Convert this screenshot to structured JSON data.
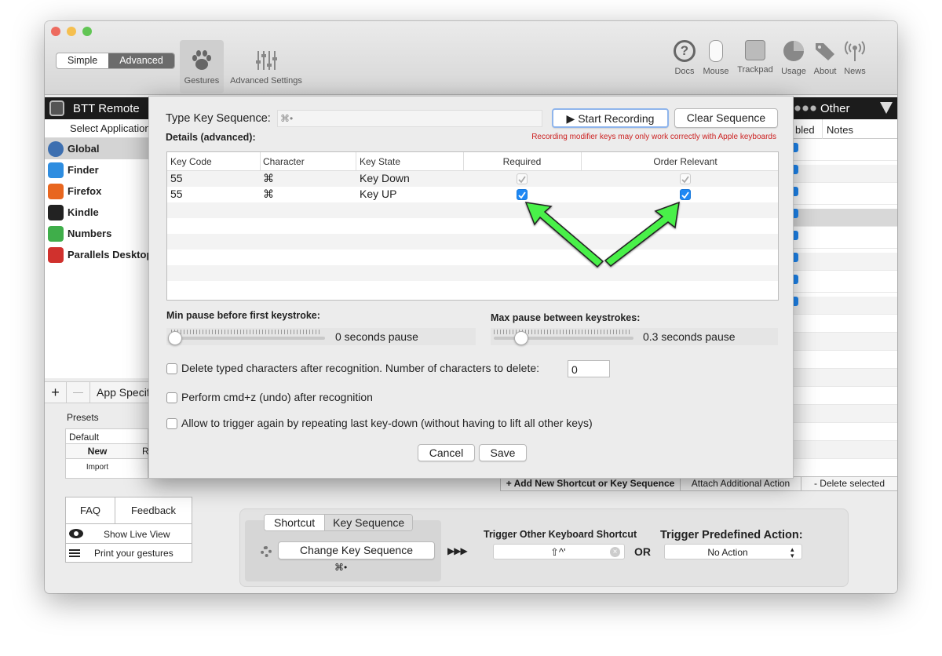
{
  "window": {
    "mode_simple": "Simple",
    "mode_advanced": "Advanced",
    "toolbar_left": [
      {
        "label": "Gestures",
        "icon": "paw-icon"
      },
      {
        "label": "Advanced Settings",
        "icon": "sliders-icon"
      }
    ],
    "toolbar_right": [
      {
        "label": "Docs",
        "icon": "question-icon"
      },
      {
        "label": "Mouse",
        "icon": "mouse-icon"
      },
      {
        "label": "Trackpad",
        "icon": "trackpad-icon"
      },
      {
        "label": "Usage",
        "icon": "pie-icon"
      },
      {
        "label": "About",
        "icon": "tag-icon"
      },
      {
        "label": "News",
        "icon": "antenna-icon"
      }
    ]
  },
  "sidebar": {
    "header_title": "BTT Remote",
    "select_label": "Select Application",
    "apps": [
      {
        "name": "Global",
        "color": "#3d6fb0"
      },
      {
        "name": "Finder",
        "color": "#2e8de0"
      },
      {
        "name": "Firefox",
        "color": "#e8661f"
      },
      {
        "name": "Kindle",
        "color": "#222222"
      },
      {
        "name": "Numbers",
        "color": "#3fae4a"
      },
      {
        "name": "Parallels Desktop",
        "color": "#d0312d"
      }
    ],
    "add_symbol": "+",
    "remove_symbol": "—",
    "app_specific": "App Specif",
    "presets_label": "Presets",
    "preset_default": "Default",
    "preset_new": "New",
    "preset_col2": "R",
    "preset_import": "Import",
    "faq": "FAQ",
    "feedback": "Feedback",
    "show_live_view": "Show Live View",
    "print_gestures": "Print your gestures"
  },
  "right_table": {
    "header_other": "Other",
    "col_enabled": "bled",
    "col_notes": "Notes"
  },
  "actions_bar": {
    "add_new": "+ Add New Shortcut or Key Sequence",
    "attach": "Attach Additional Action",
    "delete": "- Delete selected"
  },
  "bottom": {
    "tab_shortcut": "Shortcut",
    "tab_key_sequence": "Key Sequence",
    "change_key_sequence": "Change Key Sequence",
    "sequence_symbol": "⌘•",
    "arrows": "▶▶▶",
    "trigger_other": "Trigger Other Keyboard Shortcut",
    "shortcut_value": "⇧^'",
    "or": "OR",
    "trigger_predefined": "Trigger Predefined Action:",
    "no_action": "No Action"
  },
  "dialog": {
    "type_key_sequence": "Type Key Sequence:",
    "sequence_value": "⌘•",
    "start_recording": "▶ Start Recording",
    "clear_sequence": "Clear Sequence",
    "details": "Details (advanced):",
    "warning": "Recording modifier keys may only work correctly with Apple keyboards",
    "warning_color": "#cc2222",
    "columns": [
      "Key Code",
      "Character",
      "Key State",
      "Required",
      "Order Relevant"
    ],
    "rows": [
      {
        "key_code": "55",
        "character": "⌘",
        "key_state": "Key Down",
        "required": true,
        "order_relevant": true,
        "enabled": false
      },
      {
        "key_code": "55",
        "character": "⌘",
        "key_state": "Key UP",
        "required": true,
        "order_relevant": true,
        "enabled": true
      }
    ],
    "min_pause_label": "Min pause before first keystroke:",
    "min_pause_value": "0 seconds pause",
    "min_pause_level": 0,
    "max_pause_label": "Max pause between keystrokes:",
    "max_pause_value": "0.3 seconds pause",
    "max_pause_level": 0.17,
    "delete_typed": "Delete typed characters after recognition. Number of characters to delete:",
    "delete_count": "0",
    "perform_undo": "Perform cmd+z (undo) after recognition",
    "allow_trigger": "Allow to trigger again by repeating last key-down (without having to lift all other keys)",
    "cancel": "Cancel",
    "save": "Save",
    "arrow_color": "#48f048"
  }
}
